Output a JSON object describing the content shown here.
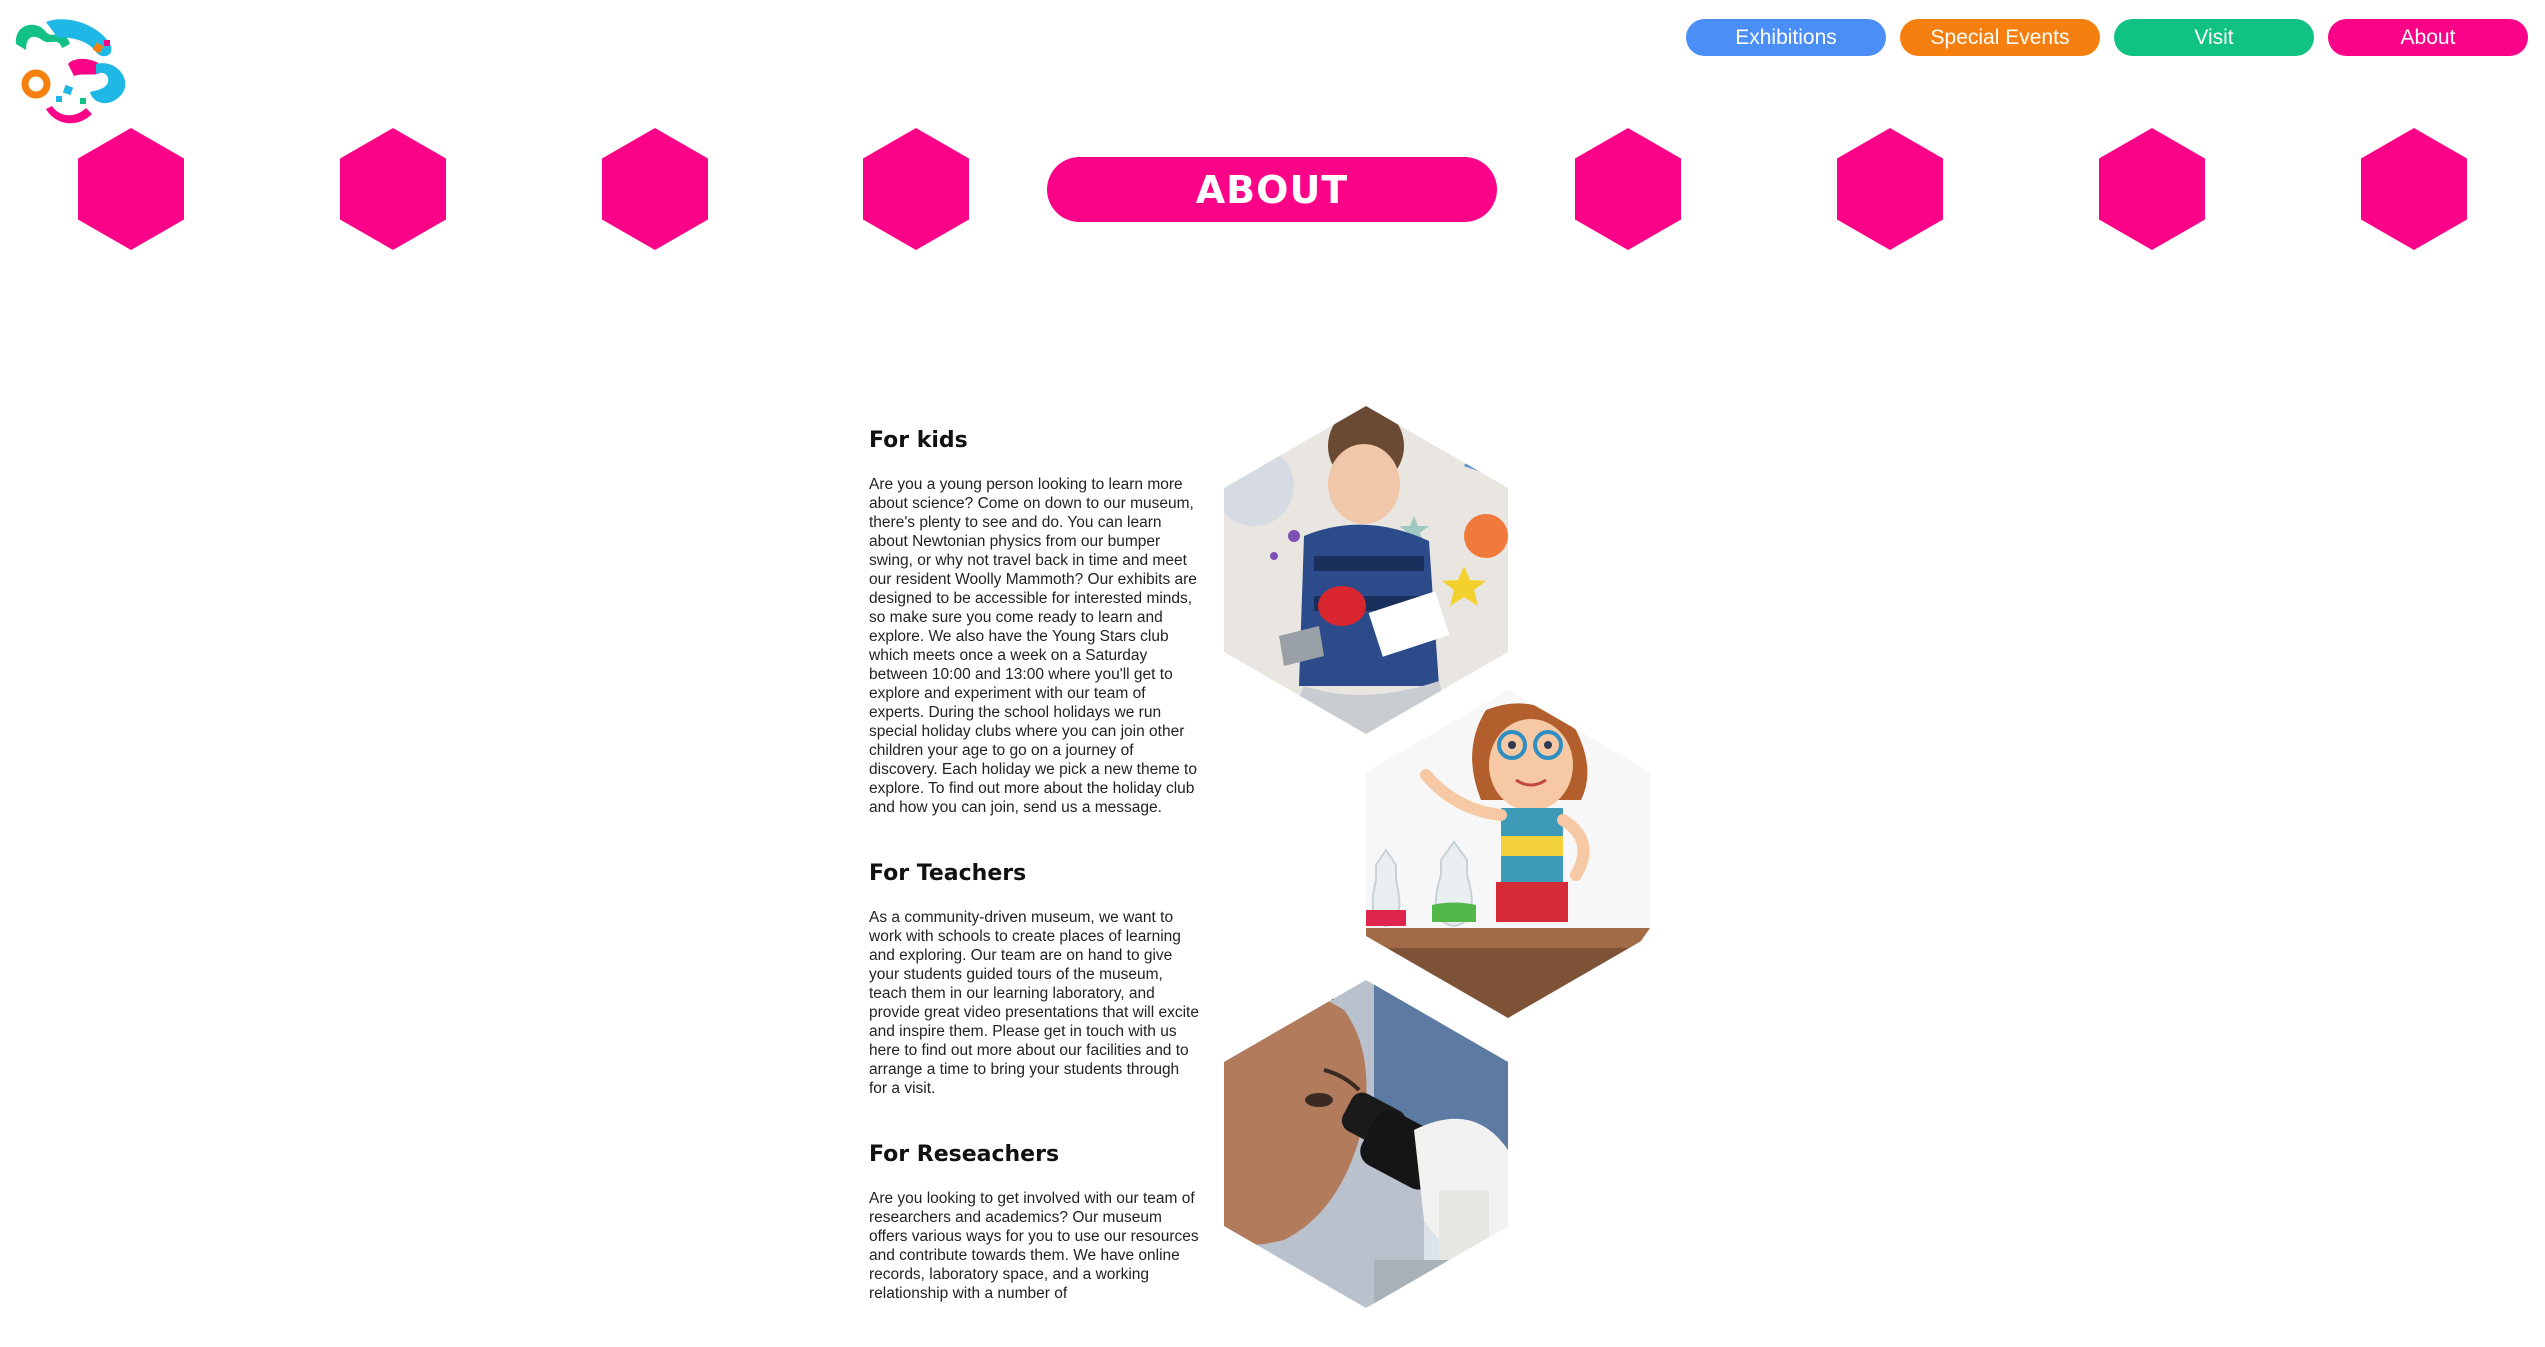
{
  "logo": {
    "name": "museum-logo",
    "icon": "paint-splash-logo"
  },
  "nav": {
    "items": [
      {
        "label": "Exhibitions",
        "color": "#4b8ef6"
      },
      {
        "label": "Special Events",
        "color": "#f5800f"
      },
      {
        "label": "Visit",
        "color": "#10c383"
      },
      {
        "label": "About",
        "color": "#fb0388"
      }
    ]
  },
  "hero": {
    "title": "ABOUT",
    "accent": "#fb0388"
  },
  "sections": [
    {
      "heading": "For kids",
      "body": "Are you a young person looking to learn more about science? Come on down to our museum, there's plenty to see and do. You can learn about Newtonian physics from our bumper swing, or why not travel back in time and meet our resident Woolly Mammoth? Our exhibits are designed to be accessible for interested minds, so make sure you come ready to learn and explore. We also have the Young Stars club which meets once a week on a Saturday between 10:00 and 13:00 where you'll get to explore and experiment with our team of experts. During the school holidays we run special holiday clubs where you can join other children your age to go on a journey of discovery. Each holiday we pick a new theme to explore. To find out more about the holiday club and how you can join, send us a message."
    },
    {
      "heading": "For Teachers",
      "body": "As a community-driven museum, we want to work with schools to create places of learning and exploring. Our team are on hand to give your students guided tours of the museum, teach them in our learning laboratory, and provide great video presentations that will excite and inspire them. Please get in touch with us here to find out more about our facilities and to arrange a time to bring your students through for a visit."
    },
    {
      "heading": "For Reseachers",
      "body": "Are you looking to get involved with our team of researchers and academics? Our museum offers various ways for you to use our resources and contribute towards them. We have online records, laboratory space, and a working relationship with a number of"
    }
  ],
  "images": [
    {
      "name": "boy-reading-photo"
    },
    {
      "name": "girl-scientist-illustration"
    },
    {
      "name": "microscope-photo"
    }
  ]
}
